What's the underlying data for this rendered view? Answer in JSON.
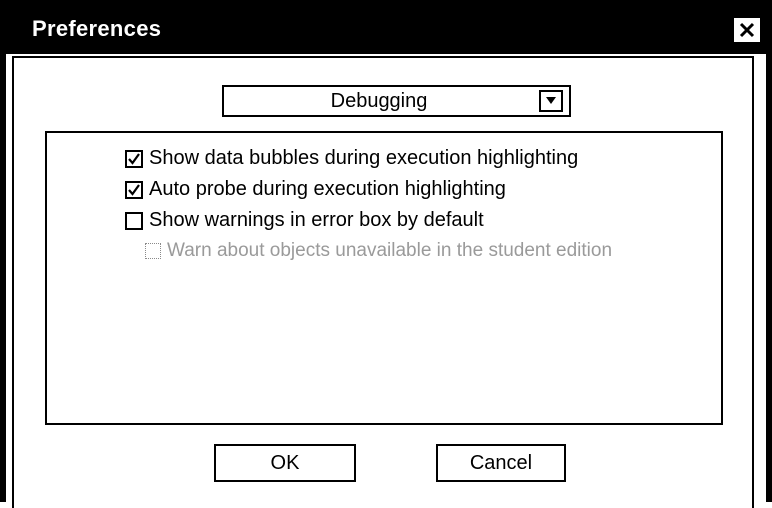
{
  "window": {
    "title": "Preferences",
    "close_icon": "close-icon"
  },
  "category_dropdown": {
    "selected": "Debugging",
    "arrow_icon": "chevron-down-icon"
  },
  "options": [
    {
      "label": "Show data bubbles during execution highlighting",
      "checked": true,
      "enabled": true
    },
    {
      "label": "Auto probe during execution highlighting",
      "checked": true,
      "enabled": true
    },
    {
      "label": "Show warnings in error box by default",
      "checked": false,
      "enabled": true
    },
    {
      "label": "Warn about objects unavailable in the student edition",
      "checked": false,
      "enabled": false
    }
  ],
  "buttons": {
    "ok": "OK",
    "cancel": "Cancel"
  }
}
